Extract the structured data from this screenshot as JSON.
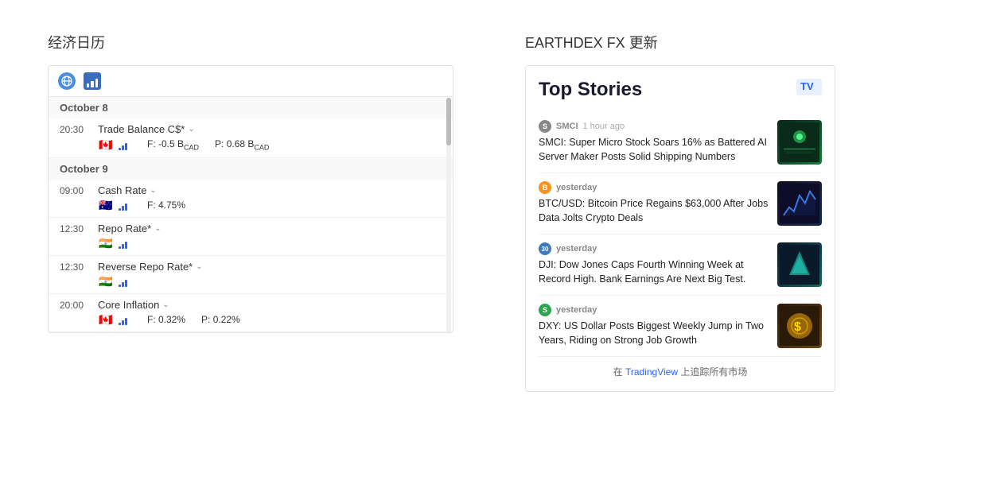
{
  "left": {
    "title": "经济日历",
    "calendar": {
      "toolbar": {
        "globe_label": "🌐",
        "bar_label": "chart"
      },
      "dates": [
        {
          "date": "October 8",
          "events": [
            {
              "time": "20:30",
              "name": "Trade Balance C$*",
              "flag": "🇨🇦",
              "forecast": "F: -0.5 B",
              "forecast_unit": "CAD",
              "previous": "P: 0.68 B",
              "previous_unit": "CAD"
            }
          ]
        },
        {
          "date": "October 9",
          "events": [
            {
              "time": "09:00",
              "name": "Cash Rate",
              "flag": "🇦🇺",
              "forecast": "F: 4.75%",
              "forecast_unit": "",
              "previous": "",
              "previous_unit": ""
            },
            {
              "time": "12:30",
              "name": "Repo Rate*",
              "flag": "🇮🇳",
              "forecast": "",
              "forecast_unit": "",
              "previous": "",
              "previous_unit": ""
            },
            {
              "time": "12:30",
              "name": "Reverse Repo Rate*",
              "flag": "🇮🇳",
              "forecast": "",
              "forecast_unit": "",
              "previous": "",
              "previous_unit": ""
            },
            {
              "time": "20:00",
              "name": "Core Inflation",
              "flag": "🇨🇦",
              "forecast": "F: 0.32%",
              "forecast_unit": "",
              "previous": "P: 0.22%",
              "previous_unit": ""
            }
          ]
        }
      ]
    }
  },
  "right": {
    "title": "EARTHDEX FX 更新",
    "widget": {
      "top_stories_label": "Top Stories",
      "tv_logo": "TV",
      "stories": [
        {
          "source_label": "S",
          "source_color": "#888888",
          "source_name": "SMCI",
          "time": "1 hour ago",
          "headline": "SMCI: Super Micro Stock Soars 16% as Battered AI Server Maker Posts Solid Shipping Numbers",
          "thumb_class": "thumb-green",
          "thumb_emoji": "🤖"
        },
        {
          "source_label": "B",
          "source_color": "#f7931a",
          "source_name": "yesterday",
          "time": "",
          "headline": "BTC/USD: Bitcoin Price Regains $63,000 After Jobs Data Jolts Crypto Deals",
          "thumb_class": "thumb-dark",
          "thumb_emoji": "📈"
        },
        {
          "source_label": "30",
          "source_color": "#3d7abf",
          "source_name": "yesterday",
          "time": "",
          "headline": "DJI: Dow Jones Caps Fourth Winning Week at Record High. Bank Earnings Are Next Big Test.",
          "thumb_class": "thumb-teal",
          "thumb_emoji": "📊"
        },
        {
          "source_label": "S",
          "source_color": "#2da44e",
          "source_name": "yesterday",
          "time": "",
          "headline": "DXY: US Dollar Posts Biggest Weekly Jump in Two Years, Riding on Strong Job Growth",
          "thumb_class": "thumb-gold",
          "thumb_emoji": "💲"
        }
      ],
      "tradingview_text": "在 TradingView 上追踪所有市场",
      "tradingview_link": "TradingView",
      "tradingview_url": "#"
    }
  }
}
